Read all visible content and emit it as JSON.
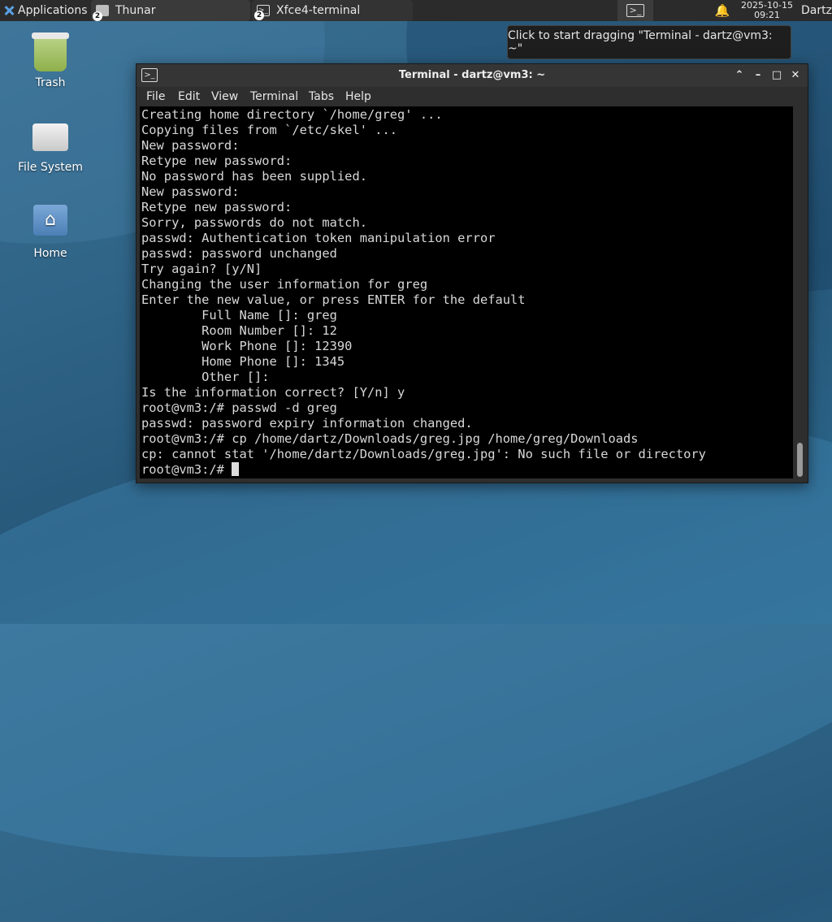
{
  "panel": {
    "applications_label": "Applications",
    "tasks": [
      {
        "label": "Thunar",
        "badge": "2"
      },
      {
        "label": "Xfce4-terminal",
        "badge": "2"
      }
    ],
    "clock_date": "2025-10-15",
    "clock_time": "09:21",
    "user": "Dartz"
  },
  "desktop": {
    "icons": [
      {
        "label": "Trash"
      },
      {
        "label": "File System"
      },
      {
        "label": "Home"
      }
    ]
  },
  "tooltip": "Click to start dragging \"Terminal - dartz@vm3: ~\"",
  "window": {
    "title": "Terminal - dartz@vm3: ~",
    "menu": [
      "File",
      "Edit",
      "View",
      "Terminal",
      "Tabs",
      "Help"
    ],
    "buttons": {
      "shade": "⌃",
      "minimize": "–",
      "maximize": "□",
      "close": "✕"
    }
  },
  "terminal": {
    "lines": [
      "Creating home directory `/home/greg' ...",
      "Copying files from `/etc/skel' ...",
      "New password:",
      "Retype new password:",
      "No password has been supplied.",
      "New password:",
      "Retype new password:",
      "Sorry, passwords do not match.",
      "passwd: Authentication token manipulation error",
      "passwd: password unchanged",
      "Try again? [y/N]",
      "Changing the user information for greg",
      "Enter the new value, or press ENTER for the default",
      "        Full Name []: greg",
      "        Room Number []: 12",
      "        Work Phone []: 12390",
      "        Home Phone []: 1345",
      "        Other []:",
      "Is the information correct? [Y/n] y",
      "root@vm3:/# passwd -d greg",
      "passwd: password expiry information changed.",
      "root@vm3:/# cp /home/dartz/Downloads/greg.jpg /home/greg/Downloads",
      "cp: cannot stat '/home/dartz/Downloads/greg.jpg': No such file or directory"
    ],
    "prompt": "root@vm3:/# "
  }
}
